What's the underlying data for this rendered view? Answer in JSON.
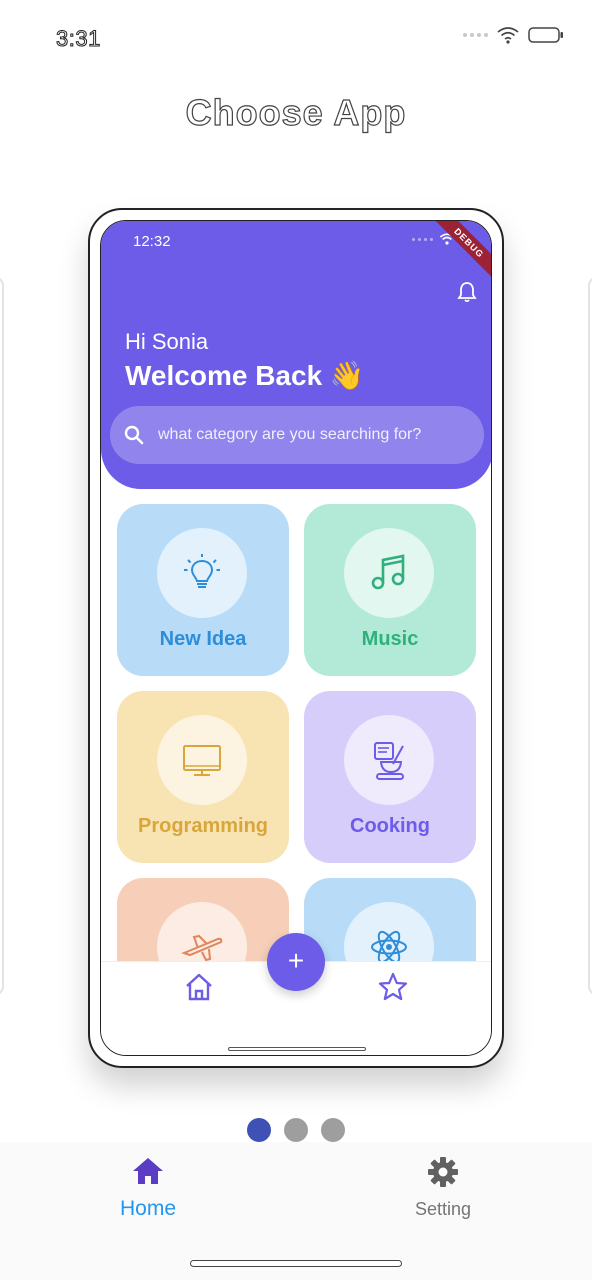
{
  "status_bar": {
    "time": "3:31"
  },
  "title": "Choose App",
  "phone": {
    "status_time": "12:32",
    "debug_label": "DEBUG",
    "greeting": "Hi Sonia",
    "welcome": "Welcome Back 👋",
    "search_placeholder": "what category are you searching for?",
    "categories": [
      {
        "label": "New Idea",
        "icon": "lightbulb-icon",
        "bg": "#b8dcf7",
        "color": "#2d8dd8"
      },
      {
        "label": "Music",
        "icon": "music-note-icon",
        "bg": "#b3ead7",
        "color": "#2fb07c"
      },
      {
        "label": "Programming",
        "icon": "monitor-icon",
        "bg": "#f8e4b3",
        "color": "#d8a63a"
      },
      {
        "label": "Cooking",
        "icon": "cooking-icon",
        "bg": "#d7cdfb",
        "color": "#6c5ce7"
      },
      {
        "label": "",
        "icon": "airplane-icon",
        "bg": "#f7cfb9",
        "color": "#e0875a"
      },
      {
        "label": "",
        "icon": "atom-icon",
        "bg": "#b8dcf7",
        "color": "#2d8dd8"
      }
    ],
    "fab_label": "+",
    "accent": "#6c5ce7"
  },
  "pager": {
    "count": 3,
    "active": 0
  },
  "tabs": [
    {
      "label": "Home",
      "icon": "home-icon",
      "color": "#2196f3"
    },
    {
      "label": "Setting",
      "icon": "gear-icon",
      "color": "#757575"
    }
  ]
}
